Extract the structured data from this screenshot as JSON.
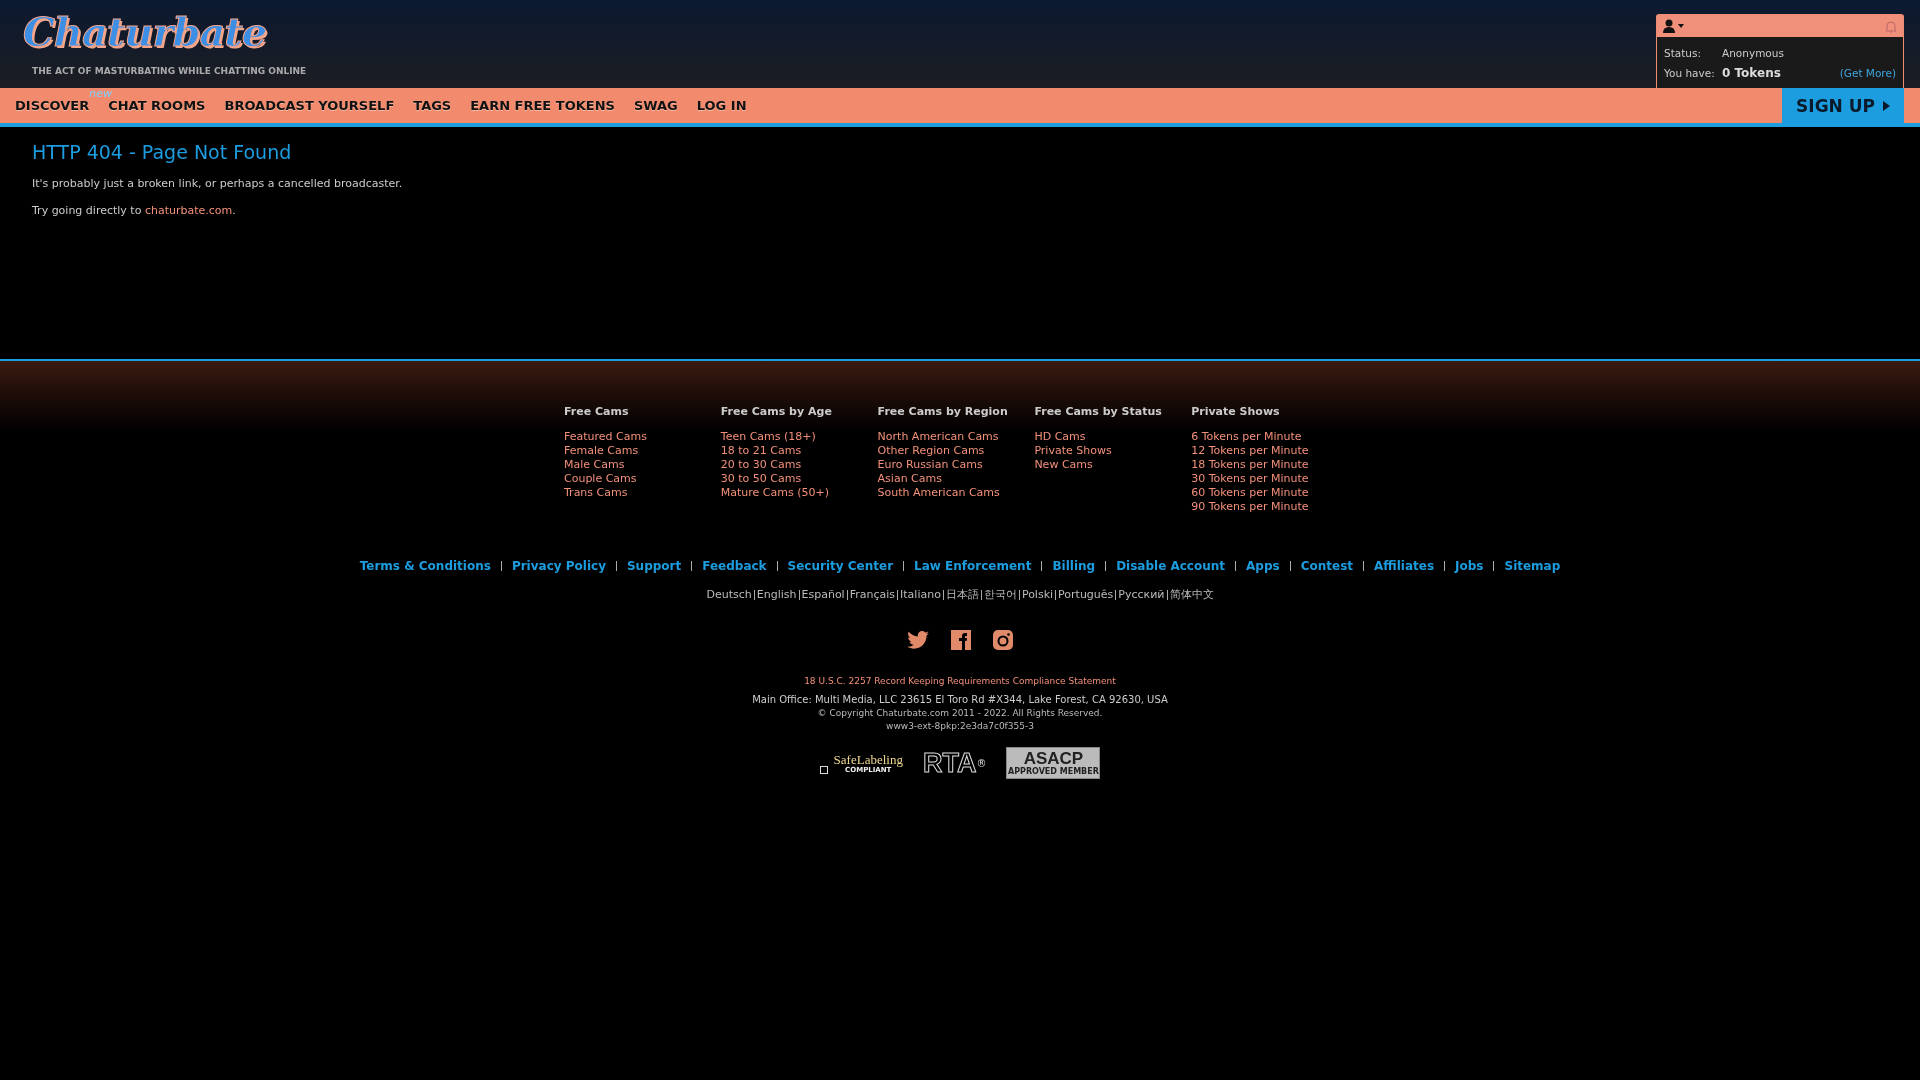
{
  "header": {
    "logo": "Chaturbate",
    "tagline": "THE ACT OF MASTURBATING WHILE CHATTING ONLINE"
  },
  "nav": [
    {
      "label": "DISCOVER",
      "badge": "new"
    },
    {
      "label": "CHAT ROOMS"
    },
    {
      "label": "BROADCAST YOURSELF"
    },
    {
      "label": "TAGS"
    },
    {
      "label": "EARN FREE TOKENS"
    },
    {
      "label": "SWAG"
    },
    {
      "label": "LOG IN"
    }
  ],
  "user_panel": {
    "status_label": "Status:",
    "status": "Anonymous",
    "tokens_label": "You have:",
    "tokens": "0 Tokens",
    "get_more": "(Get More)"
  },
  "signup": {
    "label": "SIGN UP"
  },
  "error": {
    "title": "HTTP 404 - Page Not Found",
    "message": "It's probably just a broken link, or perhaps a cancelled broadcaster.",
    "hint": "Try going directly to",
    "link": "chaturbate.com",
    "hint_end": "."
  },
  "footer_columns": [
    {
      "title": "Free Cams",
      "links": [
        "Featured Cams",
        "Female Cams",
        "Male Cams",
        "Couple Cams",
        "Trans Cams"
      ]
    },
    {
      "title": "Free Cams by Age",
      "links": [
        "Teen Cams (18+)",
        "18 to 21 Cams",
        "20 to 30 Cams",
        "30 to 50 Cams",
        "Mature Cams (50+)"
      ]
    },
    {
      "title": "Free Cams by Region",
      "links": [
        "North American Cams",
        "Other Region Cams",
        "Euro Russian Cams",
        "Asian Cams",
        "South American Cams"
      ]
    },
    {
      "title": "Free Cams by Status",
      "links": [
        "HD Cams",
        "Private Shows",
        "New Cams"
      ]
    },
    {
      "title": "Private Shows",
      "links": [
        "6 Tokens per Minute",
        "12 Tokens per Minute",
        "18 Tokens per Minute",
        "30 Tokens per Minute",
        "60 Tokens per Minute",
        "90 Tokens per Minute"
      ]
    }
  ],
  "footer_links": [
    "Terms & Conditions",
    "Privacy Policy",
    "Support",
    "Feedback",
    "Security Center",
    "Law Enforcement",
    "Billing",
    "Disable Account",
    "Apps",
    "Contest",
    "Affiliates",
    "Jobs",
    "Sitemap"
  ],
  "languages": [
    "Deutsch",
    "English",
    "Español",
    "Français",
    "Italiano",
    "日本語",
    "한국어",
    "Polski",
    "Português",
    "Русский",
    "简体中文"
  ],
  "social": [
    {
      "kind": "twitter"
    },
    {
      "kind": "facebook"
    },
    {
      "kind": "instagram"
    }
  ],
  "compliance": "18 U.S.C. 2257 Record Keeping Requirements Compliance Statement",
  "office": "Main Office: Multi Media, LLC 23615 El Toro Rd #X344, Lake Forest, CA 92630, USA",
  "copyright": "© Copyright Chaturbate.com 2011 - 2022. All Rights Reserved.",
  "server": "www3-ext-8pkp:2e3da7c0f355-3",
  "badges": [
    {
      "kind": "safelabeling",
      "text": "SafeLabeling",
      "sub": "COMPLIANT"
    },
    {
      "kind": "rta",
      "text": "RTA",
      "sub": "®"
    },
    {
      "kind": "asacp",
      "text": "ASACP",
      "sub": "APPROVED MEMBER"
    }
  ]
}
